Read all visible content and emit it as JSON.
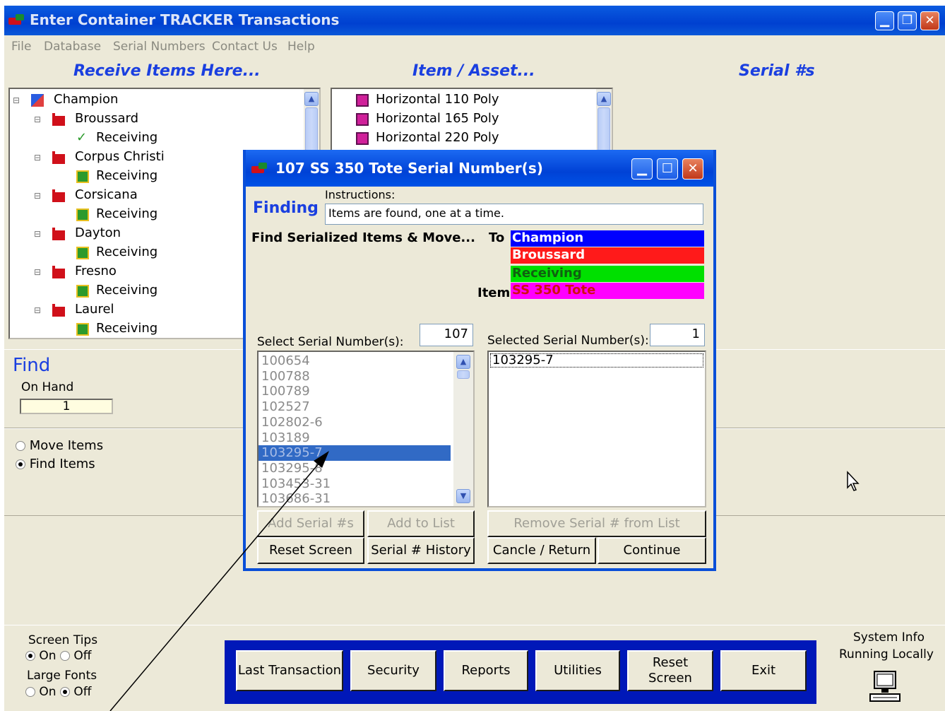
{
  "window": {
    "title": "Enter Container TRACKER Transactions",
    "min": "▁",
    "restore": "❐",
    "close": "✕"
  },
  "menu": [
    "File",
    "Database",
    "Serial Numbers",
    "Contact Us",
    "Help"
  ],
  "headers": {
    "receive": "Receive Items Here...",
    "item": "Item / Asset...",
    "serial": "Serial #s"
  },
  "tree": [
    {
      "label": "Champion",
      "icon": "company-icon"
    },
    {
      "label": "Broussard",
      "icon": "facility-icon"
    },
    {
      "label": "Receiving",
      "icon": "checkmark-icon"
    },
    {
      "label": "Corpus Christi",
      "icon": "facility-icon"
    },
    {
      "label": "Receiving",
      "icon": "receiving-icon"
    },
    {
      "label": "Corsicana",
      "icon": "facility-icon"
    },
    {
      "label": "Receiving",
      "icon": "receiving-icon"
    },
    {
      "label": "Dayton",
      "icon": "facility-icon"
    },
    {
      "label": "Receiving",
      "icon": "receiving-icon"
    },
    {
      "label": "Fresno",
      "icon": "facility-icon"
    },
    {
      "label": "Receiving",
      "icon": "receiving-icon"
    },
    {
      "label": "Laurel",
      "icon": "facility-icon"
    },
    {
      "label": "Receiving",
      "icon": "receiving-icon"
    }
  ],
  "items": [
    "Horizontal 110 Poly",
    "Horizontal 165 Poly",
    "Horizontal 220 Poly"
  ],
  "find": {
    "title": "Find",
    "onhand_label": "On Hand",
    "onhand_value": "1"
  },
  "mode": {
    "move": "Move Items",
    "find": "Find Items",
    "selected": "find"
  },
  "dialog": {
    "title": "107 SS 350 Tote Serial Number(s)",
    "mode": "Finding",
    "instructions_label": "Instructions:",
    "instructions": "Items are found, one at a time.",
    "heading": "Find Serialized Items & Move...",
    "to_label": "To",
    "item_label": "Item",
    "to": {
      "company": "Champion",
      "facility": "Broussard",
      "location": "Receiving"
    },
    "item": "SS 350 Tote",
    "colors": {
      "company": "#0000ff",
      "facility": "#ff1a1a",
      "location": "#00e000",
      "item": "#ff00ff"
    },
    "select_label": "Select Serial Number(s):",
    "select_count": "107",
    "selected_label": "Selected Serial Number(s):",
    "selected_count": "1",
    "serials": [
      "100654",
      "100788",
      "100789",
      "102527",
      "102802-6",
      "103189",
      "103295-7",
      "103295-8",
      "103453-31",
      "103686-31"
    ],
    "highlighted_serial": "103295-7",
    "selected_serials": [
      "103295-7"
    ],
    "buttons": {
      "add_serial": "Add Serial #s",
      "add_list": "Add to List",
      "remove": "Remove Serial #  from List",
      "reset": "Reset Screen",
      "history": "Serial # History",
      "cancel": "Cancle / Return",
      "continue": "Continue"
    }
  },
  "bottom": {
    "screen_tips": "Screen Tips",
    "large_fonts": "Large Fonts",
    "on": "On",
    "off": "Off",
    "buttons": [
      "Last Transaction",
      "Security",
      "Reports",
      "Utilities",
      "Reset Screen",
      "Exit"
    ],
    "system_info": "System Info",
    "running": "Running Locally"
  }
}
